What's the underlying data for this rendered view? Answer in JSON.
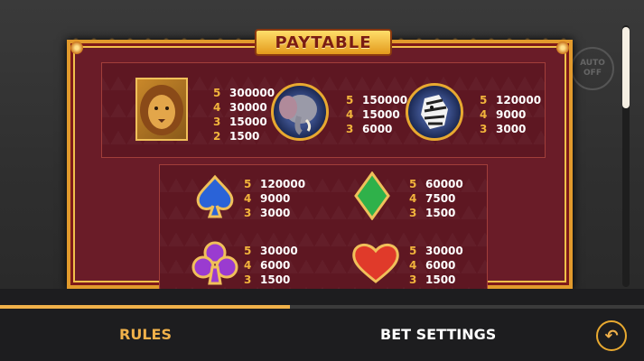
{
  "title": "PAYTABLE",
  "auto_button": {
    "label_line1": "AUTO",
    "label_line2": "OFF"
  },
  "premium_symbols": [
    {
      "name": "lion",
      "icon": "lion-icon",
      "pays": [
        {
          "count": "5",
          "value": "300000"
        },
        {
          "count": "4",
          "value": "30000"
        },
        {
          "count": "3",
          "value": "15000"
        },
        {
          "count": "2",
          "value": "1500"
        }
      ]
    },
    {
      "name": "elephant",
      "icon": "elephant-icon",
      "pays": [
        {
          "count": "5",
          "value": "150000"
        },
        {
          "count": "4",
          "value": "15000"
        },
        {
          "count": "3",
          "value": "6000"
        }
      ]
    },
    {
      "name": "zebra",
      "icon": "zebra-icon",
      "pays": [
        {
          "count": "5",
          "value": "120000"
        },
        {
          "count": "4",
          "value": "9000"
        },
        {
          "count": "3",
          "value": "3000"
        }
      ]
    }
  ],
  "card_symbols": [
    {
      "name": "spade",
      "icon": "spade-icon",
      "color": "#2a63d8",
      "pays": [
        {
          "count": "5",
          "value": "120000"
        },
        {
          "count": "4",
          "value": "9000"
        },
        {
          "count": "3",
          "value": "3000"
        }
      ]
    },
    {
      "name": "diamond",
      "icon": "diamond-icon",
      "color": "#2fb14a",
      "pays": [
        {
          "count": "5",
          "value": "60000"
        },
        {
          "count": "4",
          "value": "7500"
        },
        {
          "count": "3",
          "value": "1500"
        }
      ]
    },
    {
      "name": "club",
      "icon": "club-icon",
      "color": "#9a3bd0",
      "pays": [
        {
          "count": "5",
          "value": "30000"
        },
        {
          "count": "4",
          "value": "6000"
        },
        {
          "count": "3",
          "value": "1500"
        }
      ]
    },
    {
      "name": "heart",
      "icon": "heart-icon",
      "color": "#e03a2a",
      "pays": [
        {
          "count": "5",
          "value": "30000"
        },
        {
          "count": "4",
          "value": "6000"
        },
        {
          "count": "3",
          "value": "1500"
        }
      ]
    }
  ],
  "scroll_progress": 0.45,
  "nav": {
    "rules": "RULES",
    "bet_settings": "BET SETTINGS"
  },
  "back_icon": "back-arrow-icon"
}
